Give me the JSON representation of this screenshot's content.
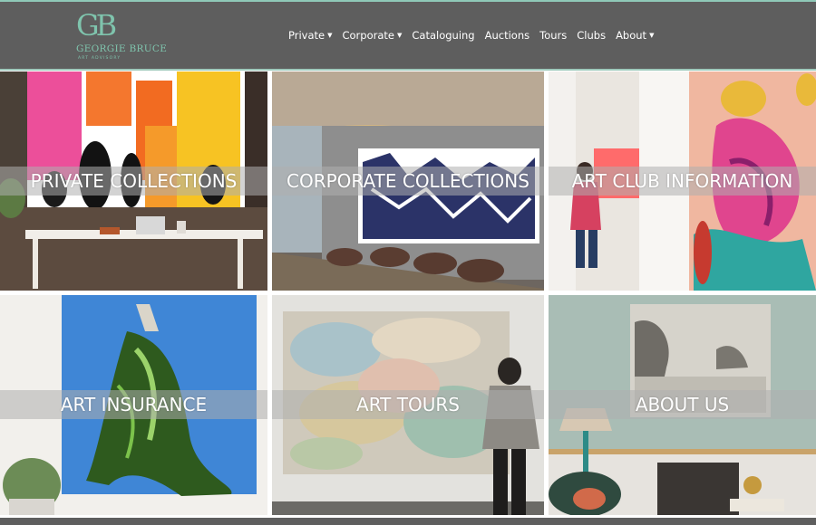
{
  "brand": {
    "mark": "GB",
    "name": "GEORGIE BRUCE",
    "tagline": "ART ADVISORY"
  },
  "nav": [
    {
      "label": "Private",
      "dropdown": true
    },
    {
      "label": "Corporate",
      "dropdown": true
    },
    {
      "label": "Cataloguing",
      "dropdown": false
    },
    {
      "label": "Auctions",
      "dropdown": false
    },
    {
      "label": "Tours",
      "dropdown": false
    },
    {
      "label": "Clubs",
      "dropdown": false
    },
    {
      "label": "About",
      "dropdown": true
    }
  ],
  "tiles": [
    {
      "caption": "PRIVATE COLLECTIONS"
    },
    {
      "caption": "CORPORATE COLLECTIONS"
    },
    {
      "caption": "ART CLUB INFORMATION"
    },
    {
      "caption": "ART INSURANCE"
    },
    {
      "caption": "ART TOURS"
    },
    {
      "caption": "ABOUT US"
    }
  ],
  "colors": {
    "header": "#5e5e5e",
    "brand": "#7fc4ad",
    "band": "rgba(175,175,175,0.55)"
  },
  "icons": {
    "dropdown": "caret-down-icon"
  }
}
